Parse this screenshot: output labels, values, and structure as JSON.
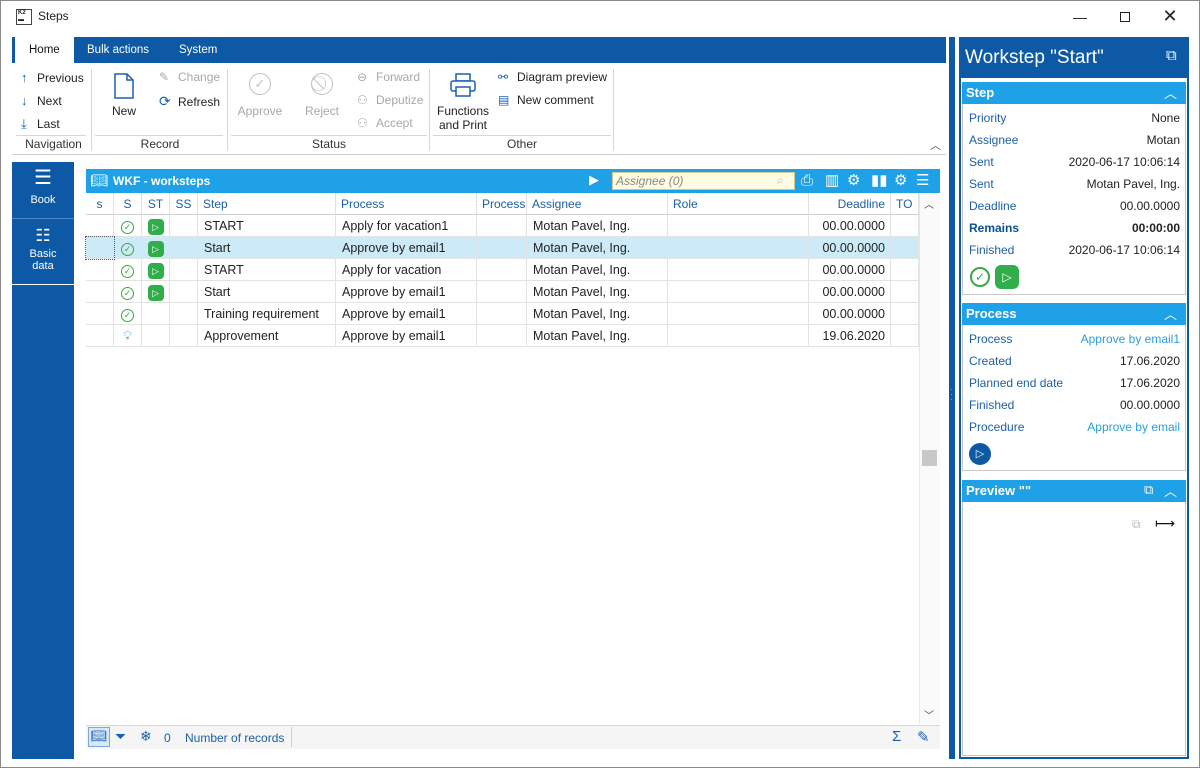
{
  "window": {
    "title": "Steps"
  },
  "ribbon": {
    "tabs": [
      "Home",
      "Bulk actions",
      "System"
    ],
    "navigation": {
      "previous": "Previous",
      "next": "Next",
      "last": "Last",
      "label": "Navigation"
    },
    "record": {
      "new": "New",
      "change": "Change",
      "refresh": "Refresh",
      "label": "Record"
    },
    "status": {
      "approve": "Approve",
      "reject": "Reject",
      "forward": "Forward",
      "deputize": "Deputize",
      "accept": "Accept",
      "label": "Status"
    },
    "other": {
      "functions_line1": "Functions",
      "functions_line2": "and Print",
      "diagram_preview": "Diagram preview",
      "new_comment": "New comment",
      "label": "Other"
    }
  },
  "leftnav": {
    "book": "Book",
    "basic_line1": "Basic",
    "basic_line2": "data"
  },
  "grid": {
    "title": "WKF - worksteps",
    "search_placeholder": "Assignee (0)",
    "columns": [
      "s",
      "S",
      "ST",
      "SS",
      "Step",
      "Process",
      "Process s",
      "Assignee",
      "Role",
      "Deadline",
      "TO"
    ],
    "rows": [
      {
        "step": "START",
        "process": "Apply for vacation1",
        "assignee": "Motan Pavel, Ing.",
        "deadline": "00.00.0000",
        "s_icon": "check-circle-icon",
        "st_icon": "play-icon"
      },
      {
        "step": "Start",
        "process": "Approve by email1",
        "assignee": "Motan Pavel, Ing.",
        "deadline": "00.00.0000",
        "s_icon": "check-circle-icon",
        "st_icon": "play-icon"
      },
      {
        "step": "START",
        "process": "Apply for vacation",
        "assignee": "Motan Pavel, Ing.",
        "deadline": "00.00.0000",
        "s_icon": "check-circle-icon",
        "st_icon": "play-icon"
      },
      {
        "step": "Start",
        "process": "Approve by email1",
        "assignee": "Motan Pavel, Ing.",
        "deadline": "00.00.0000",
        "s_icon": "check-circle-icon",
        "st_icon": "play-icon"
      },
      {
        "step": "Training requirement",
        "process": "Approve by email1",
        "assignee": "Motan Pavel, Ing.",
        "deadline": "00.00.0000",
        "s_icon": "check-circle-icon",
        "st_icon": ""
      },
      {
        "step": "Approvement",
        "process": "Approve by email1",
        "assignee": "Motan Pavel, Ing.",
        "deadline": "19.06.2020",
        "s_icon": "bulb-icon",
        "st_icon": ""
      }
    ],
    "status": {
      "count": "0",
      "records_label": "Number of records"
    }
  },
  "panel": {
    "title": "Workstep \"Start\"",
    "step": {
      "header": "Step",
      "fields": [
        {
          "label": "Priority",
          "value": "None"
        },
        {
          "label": "Assignee",
          "value": "Motan"
        },
        {
          "label": "Sent",
          "value": "2020-06-17 10:06:14"
        },
        {
          "label": "Sent",
          "value": "Motan Pavel, Ing."
        },
        {
          "label": "Deadline",
          "value": "00.00.0000"
        },
        {
          "label": "Remains",
          "value": "00:00:00"
        },
        {
          "label": "Finished",
          "value": "2020-06-17 10:06:14"
        }
      ]
    },
    "process": {
      "header": "Process",
      "fields": [
        {
          "label": "Process",
          "value": "Approve by email1"
        },
        {
          "label": "Created",
          "value": "17.06.2020"
        },
        {
          "label": "Planned end date",
          "value": "17.06.2020"
        },
        {
          "label": "Finished",
          "value": "00.00.0000"
        },
        {
          "label": "Procedure",
          "value": "Approve by email"
        }
      ]
    },
    "preview": {
      "header": "Preview \"\""
    }
  },
  "colors": {
    "brand": "#0d59a6",
    "accent": "#1ea1e6",
    "selected_row": "#cdeaf8",
    "ok_green": "#2fae4a"
  }
}
